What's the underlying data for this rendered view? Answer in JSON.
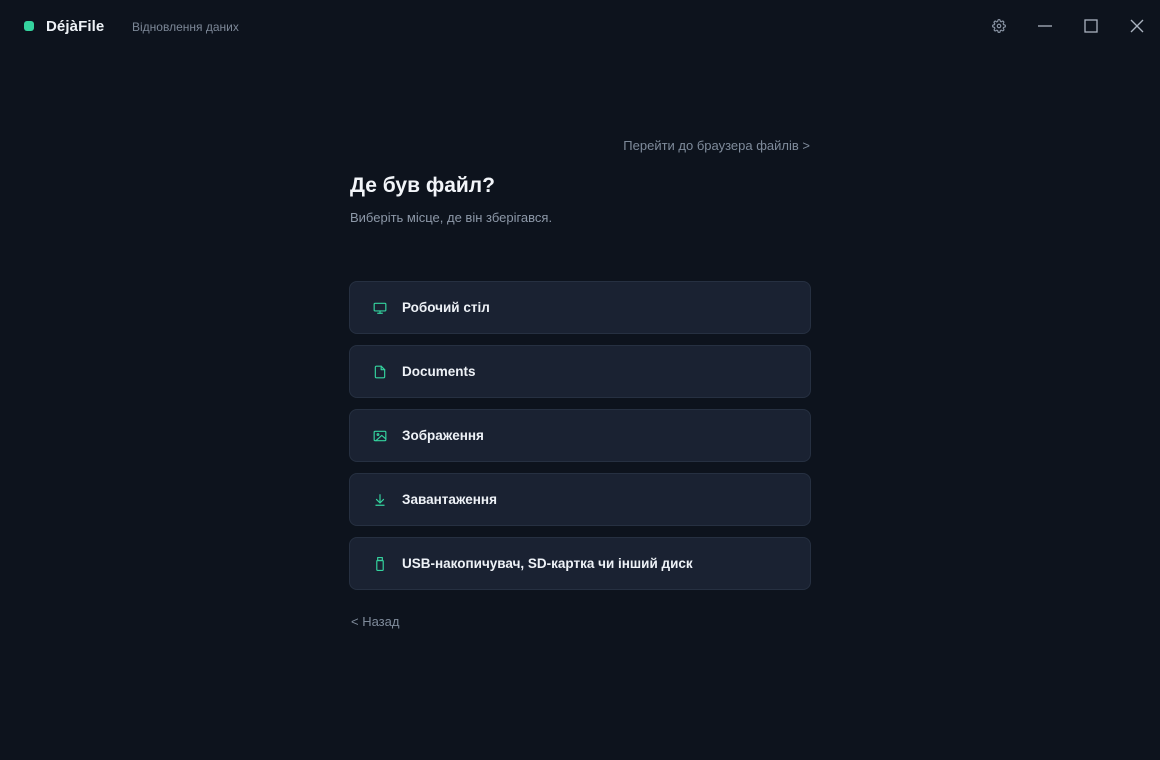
{
  "app": {
    "name": "DéjàFile",
    "subtitle": "Відновлення даних",
    "accent_color": "#34d39e"
  },
  "window_controls": {
    "settings_icon": "gear-icon",
    "minimize_icon": "minimize-icon",
    "maximize_icon": "maximize-icon",
    "close_icon": "close-icon"
  },
  "main": {
    "browse_link": "Перейти до браузера файлів >",
    "title": "Де був файл?",
    "subtitle": "Виберіть місце, де він зберігався.",
    "options": [
      {
        "label": "Робочий стіл",
        "icon": "monitor-icon"
      },
      {
        "label": "Documents",
        "icon": "document-icon"
      },
      {
        "label": "Зображення",
        "icon": "image-icon"
      },
      {
        "label": "Завантаження",
        "icon": "download-icon"
      },
      {
        "label": "USB-накопичувач, SD-картка чи інший диск",
        "icon": "usb-drive-icon"
      }
    ],
    "back_link": "< Назад"
  }
}
